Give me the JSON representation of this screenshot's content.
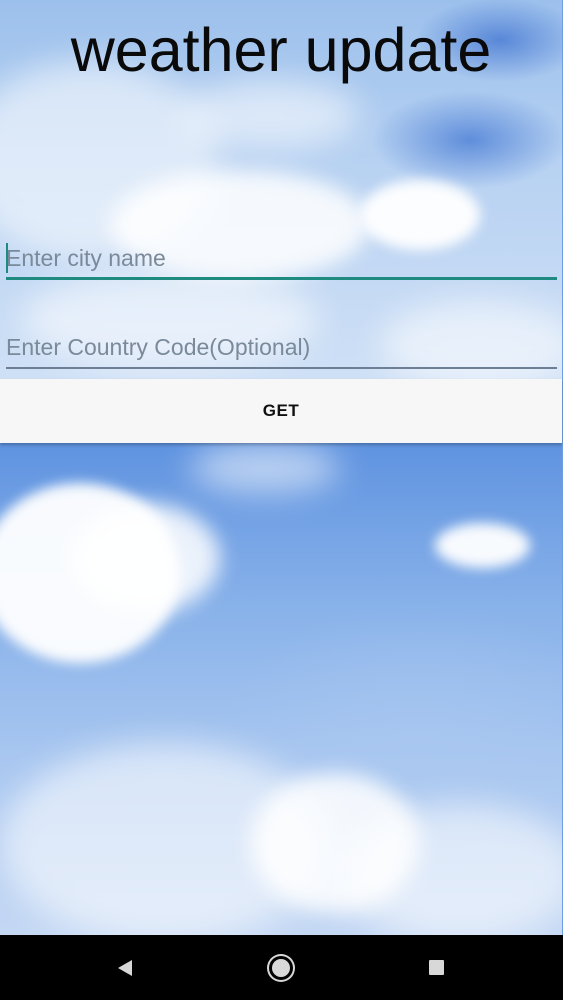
{
  "app": {
    "title": "weather update"
  },
  "form": {
    "city_placeholder": "Enter city name",
    "city_value": "",
    "country_placeholder": "Enter Country Code(Optional)",
    "country_value": ""
  },
  "actions": {
    "get_label": "GET"
  },
  "colors": {
    "accent": "#1f8a7f",
    "button_bg": "#f7f7f7",
    "navbar_bg": "#000000"
  },
  "navbar": {
    "back_icon": "back-triangle-icon",
    "home_icon": "home-circle-icon",
    "recents_icon": "recents-square-icon"
  }
}
